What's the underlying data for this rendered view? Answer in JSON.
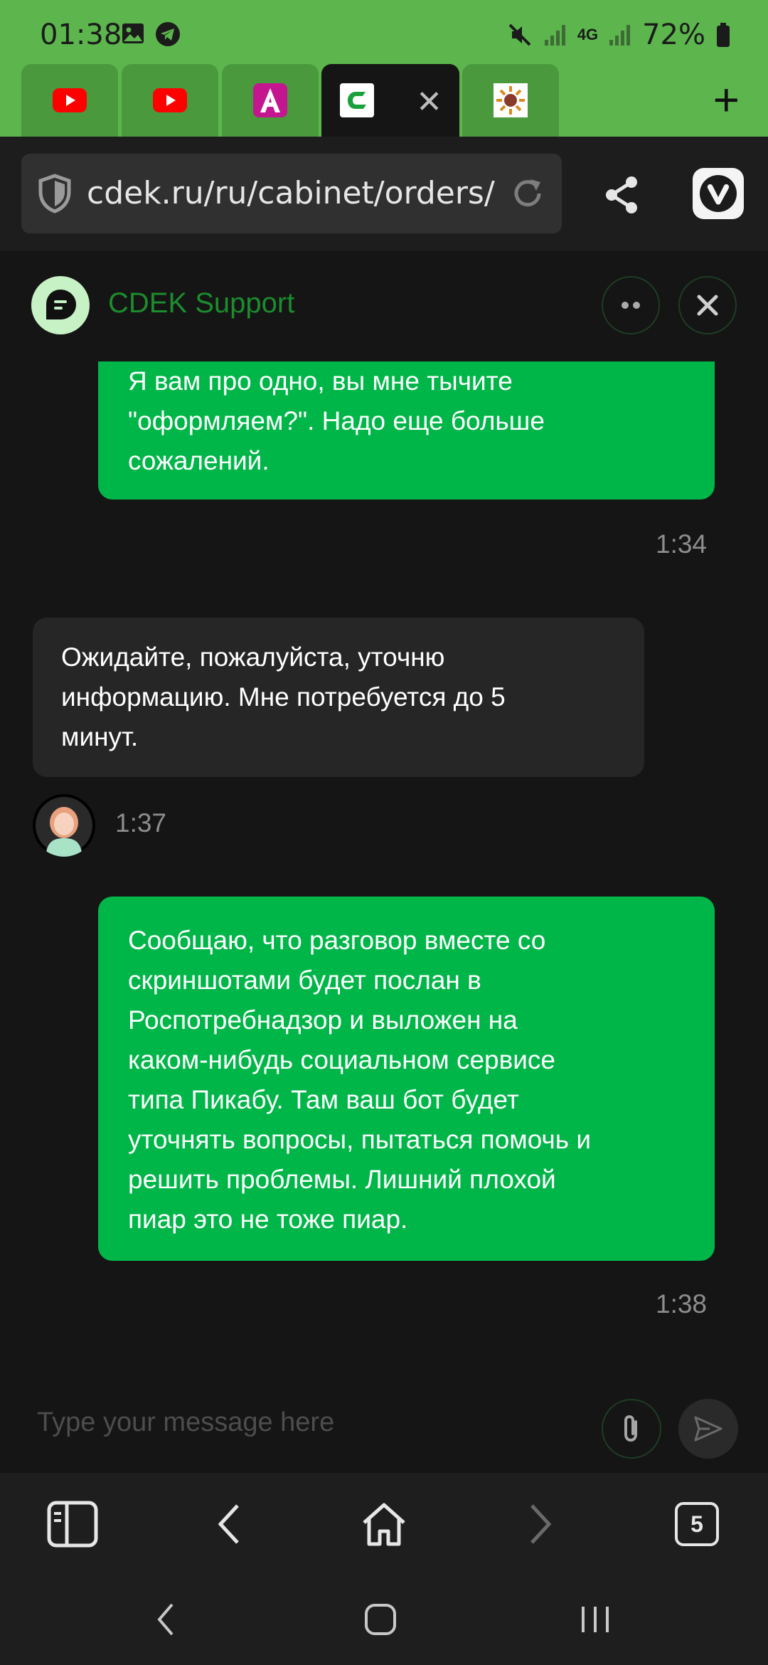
{
  "status_bar": {
    "time": "01:38",
    "battery": "72%",
    "network": "4G"
  },
  "browser": {
    "tabs": [
      {
        "icon": "youtube-icon",
        "active": false
      },
      {
        "icon": "youtube-icon",
        "active": false
      },
      {
        "icon": "a-app-icon",
        "active": false
      },
      {
        "icon": "cdek-icon",
        "active": true
      },
      {
        "icon": "sun-favicon",
        "active": false
      }
    ],
    "url": "cdek.ru/ru/cabinet/orders/",
    "tab_count": "5"
  },
  "chat": {
    "title": "CDEK Support",
    "messages": [
      {
        "direction": "out",
        "lines": [
          "Я вам про одно, вы мне тычите",
          "\"оформляем?\". Надо еще больше",
          "сожалений."
        ],
        "time": "1:34"
      },
      {
        "direction": "in",
        "lines": [
          "Ожидайте, пожалуйста, уточню",
          "информацию. Мне потребуется до 5",
          "минут."
        ],
        "time": "1:37"
      },
      {
        "direction": "out",
        "lines": [
          "Сообщаю, что разговор вместе со",
          "скриншотами будет послан в",
          "Роспотребнадзор и выложен на",
          "каком-нибудь социальном сервисе",
          "типа Пикабу. Там ваш бот будет",
          "уточнять вопросы, пытаться помочь и",
          "решить проблемы. Лишний плохой",
          "пиар это не тоже пиар."
        ],
        "time": "1:38"
      }
    ],
    "composer_placeholder": "Type your message here"
  },
  "colors": {
    "brand_green": "#5cb64d",
    "bubble_out": "#00b648",
    "bubble_in": "#262626",
    "title_green": "#1c8c2d"
  }
}
